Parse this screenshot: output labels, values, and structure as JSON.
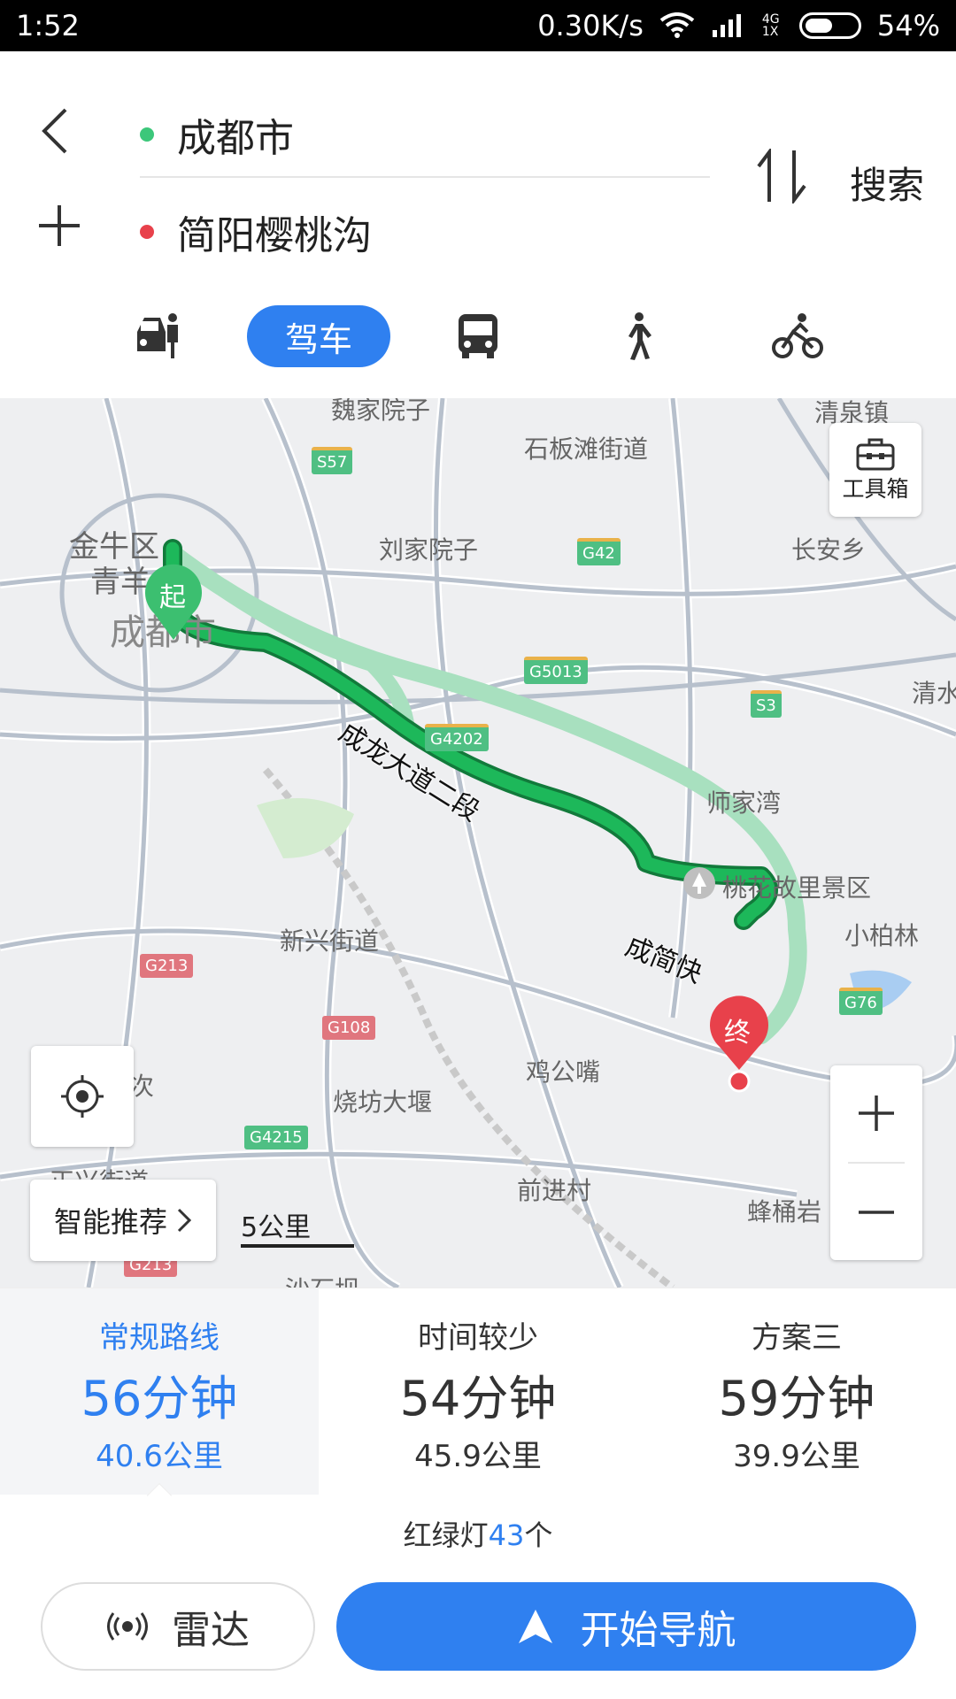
{
  "status_bar": {
    "time": "1:52",
    "net_speed": "0.30K/s",
    "network": "4G 1X",
    "battery": "54%",
    "battery_level": 0.54
  },
  "route_input": {
    "origin": "成都市",
    "destination": "简阳樱桃沟",
    "search_label": "搜索"
  },
  "modes": {
    "active_label": "驾车",
    "icons": [
      "taxi-icon",
      "bus-icon",
      "walk-icon",
      "bike-icon"
    ]
  },
  "map": {
    "toolbox_label": "工具箱",
    "start_marker": "起",
    "end_marker": "终",
    "smart_recommend": "智能推荐",
    "scale": "5公里",
    "road_names": [
      "成龙大道二段",
      "成简快"
    ],
    "labels": {
      "l1": "魏家院子",
      "l2": "清泉镇",
      "l3": "石板滩街道",
      "l4": "金牛区",
      "l5": "青羊",
      "l6": "刘家院子",
      "l7": "长安乡",
      "l8": "成都市",
      "l9": "清水",
      "l10": "师家湾",
      "l11": "桃花故里景区",
      "l12": "小柏林",
      "l13": "新兴街道",
      "l14": "鸡公嘴",
      "l15": "烧坊大堰",
      "l16": "前进村",
      "l17": "蜂桶岩",
      "l18": "正兴街道",
      "l19": "沙石坝",
      "l20": "次"
    },
    "shields": {
      "s57": "S57",
      "g42": "G42",
      "g5013": "G5013",
      "s3": "S3",
      "g4202": "G4202",
      "g76": "G76",
      "g213": "G213",
      "g108": "G108",
      "g4215": "G4215",
      "g213b": "G213"
    }
  },
  "routes": [
    {
      "name": "常规路线",
      "time": "56分钟",
      "distance": "40.6公里"
    },
    {
      "name": "时间较少",
      "time": "54分钟",
      "distance": "45.9公里"
    },
    {
      "name": "方案三",
      "time": "59分钟",
      "distance": "39.9公里"
    }
  ],
  "traffic": {
    "prefix": "红绿灯",
    "count": "43",
    "suffix": "个"
  },
  "actions": {
    "radar": "雷达",
    "navigate": "开始导航"
  },
  "colors": {
    "accent": "#2f80f0",
    "route_main": "#1db85a",
    "route_alt": "#a8e0bf",
    "start": "#3cbf70",
    "end": "#e8414b"
  }
}
